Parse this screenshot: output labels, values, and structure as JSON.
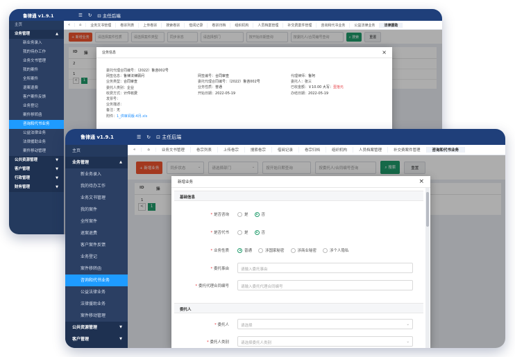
{
  "app": {
    "title": "鲁律通 v1.9.1",
    "menu_icon": "menu-icon",
    "refresh_icon": "refresh-icon",
    "home_link": "主任后端"
  },
  "sidebar": {
    "home": "主页",
    "business": "业务管理",
    "items": [
      "新业务录入",
      "我的待办工作",
      "业务文书管理",
      "我的案件",
      "全所案件",
      "退案退费",
      "客户案件反馈",
      "业务登记",
      "案件移转函",
      "咨询和代书业务",
      "公益法律业务",
      "法律援助业务",
      "案件移动管理"
    ],
    "public": "公共资源管理",
    "customer": "客户管理",
    "admin": "行政管理",
    "finance": "财务管理"
  },
  "back_tabs": [
    "«",
    "⌂",
    "业务文书管理",
    "卷宗列表",
    "上传卷宗",
    "搜索卷宗",
    "借阅记录",
    "卷宗归档",
    "组织机构",
    "人员档案管理",
    "补交费案件管理",
    "咨询和代书业务",
    "公益法律业务",
    "法律援助"
  ],
  "front_tabs": [
    "«",
    "⌂",
    "业务文书管理",
    "卷宗列表",
    "上传卷宗",
    "搜索卷宗",
    "借阅记录",
    "卷宗归档",
    "组织机构",
    "人员档案管理",
    "补交费案件管理",
    "咨询和代书业务"
  ],
  "toolbar": {
    "new_button": "+ 新增业务",
    "sel_case_nature": "请选择案件性质",
    "sel_case_type": "请选择案件类型",
    "sel_sync": "同步状态",
    "sel_dept": "请选择部门",
    "date_input": "按开始日期查询",
    "search_input": "按委托人/合同编号查询",
    "search_button": "搜索",
    "reset_button": "重置"
  },
  "table": {
    "head": [
      "ID",
      "操"
    ],
    "rows": [
      "2",
      "1"
    ],
    "pager": [
      "<",
      "1",
      ">"
    ]
  },
  "detail_modal": {
    "title": "业务信息",
    "close": "×",
    "col1": [
      {
        "k": "委托代理合同编号：",
        "v": "（2022）鲁咨002号"
      },
      {
        "k": "网签信息：",
        "v": "鲁律法律顾问"
      },
      {
        "k": "业务类型：",
        "v": "合同审查"
      },
      {
        "k": "委托人类别：",
        "v": "企业"
      },
      {
        "k": "收费方式：",
        "v": "计件收费"
      },
      {
        "k": "发票号：",
        "v": ""
      },
      {
        "k": "业务描述：",
        "v": ""
      },
      {
        "k": "备注：",
        "v": "无"
      },
      {
        "k": "附件：",
        "v": "1_供审阅版-4月.xls"
      }
    ],
    "col2": [
      {
        "k": "网签编号：",
        "v": "合同审查"
      },
      {
        "k": "委托代理合同编号：",
        "v": "（2022）鲁咨002号"
      },
      {
        "k": "业务性质：",
        "v": "普通"
      },
      {
        "k": "开始日期：",
        "v": "2022-05-19"
      }
    ],
    "col3": [
      {
        "k": "代理律师：",
        "v": "鲁阿"
      },
      {
        "k": "委托人：",
        "v": "张三"
      },
      {
        "k": "已收金额：",
        "v": "￥10.00 大写：",
        "red": "壹拾元"
      },
      {
        "k": "办结日期：",
        "v": "2022-05-19"
      }
    ]
  },
  "new_modal": {
    "title": "新增业务",
    "close": "×",
    "section_basic": "基础信息",
    "consult_label": "是否咨询",
    "proxy_label": "是否代书",
    "yes": "是",
    "no": "否",
    "nature_label": "业务性质",
    "nature_options": [
      "普通",
      "涉国家秘密",
      "涉商业秘密",
      "涉个人隐私"
    ],
    "reason_label": "委托事由",
    "reason_placeholder": "请输入委托事由",
    "contract_label": "委托代理合同编号",
    "contract_placeholder": "请输入委托代理合同编号",
    "section_client": "委托人",
    "client_label": "委托人",
    "client_placeholder": "请选择",
    "client_type_label": "委托人类别",
    "client_type_placeholder": "请选择委托人类别"
  }
}
